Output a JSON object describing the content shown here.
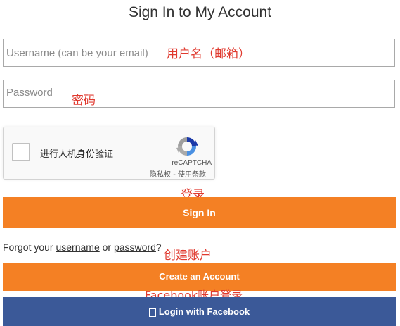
{
  "page": {
    "title": "Sign In to My Account"
  },
  "form": {
    "username_placeholder": "Username (can be your email)",
    "password_placeholder": "Password"
  },
  "annotations": {
    "username_note": "用户名（邮箱）",
    "password_note": "密码",
    "login_note": "登录",
    "create_note": "创建账户",
    "facebook_note": "Facebook账户登录",
    "color": "#e03a2f"
  },
  "captcha": {
    "label": "进行人机身份验证",
    "brand": "reCAPTCHA",
    "links": "隐私权 - 使用条款",
    "icon": "recaptcha-logo"
  },
  "buttons": {
    "signin_label": "Sign In",
    "create_label": "Create an Account",
    "facebook_label": "Login with Facebook",
    "accent_color": "#f48024",
    "facebook_color": "#3b5998"
  },
  "forgot": {
    "prefix": "Forgot your ",
    "username_link": "username",
    "or": " or ",
    "password_link": "password",
    "suffix": "?"
  }
}
